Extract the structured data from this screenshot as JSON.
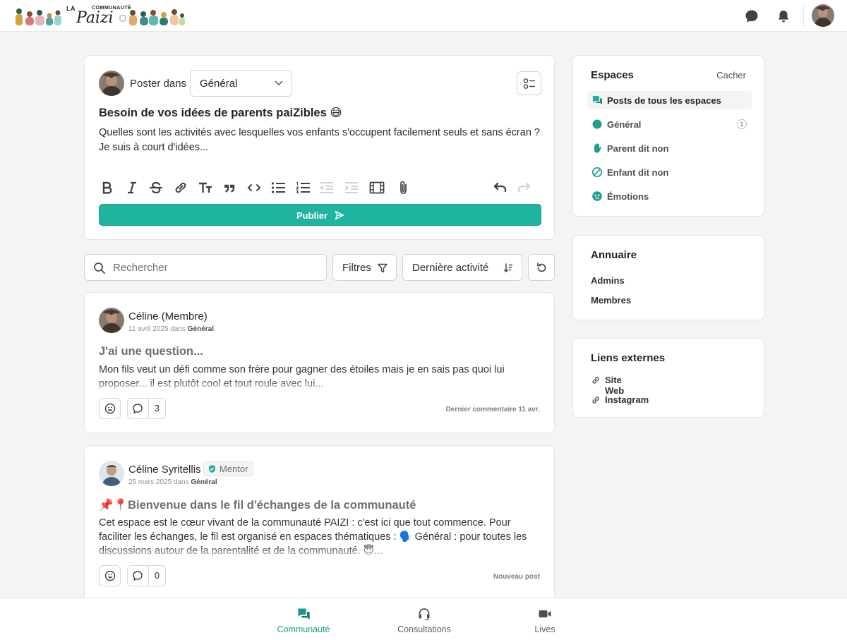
{
  "colors": {
    "accent": "#1fb4a0",
    "accent_dark": "#169c8b",
    "mentor_check": "#1fb4a0"
  },
  "header": {
    "logo": {
      "la": "LA",
      "communaute": "COMMUNAUTÉ",
      "paizi": "Paizi"
    },
    "icons": [
      "chat-bubble-icon",
      "bell-icon"
    ]
  },
  "composer": {
    "post_in_label": "Poster dans",
    "space_select": "Général",
    "title": "Besoin de vos idées de parents paiZibles 😅",
    "body": "Quelles sont les activités avec lesquelles vos enfants s'occupent facilement seuls et sans écran ? Je suis à court d'idées...",
    "publish_label": "Publier"
  },
  "search": {
    "placeholder": "Rechercher"
  },
  "filters_label": "Filtres",
  "sort_label": "Dernière activité",
  "posts": [
    {
      "author": "Céline (Membre)",
      "date": "11 avril 2025",
      "in_word": "dans",
      "space": "Général",
      "title": "J'ai une question...",
      "excerpt": "Mon fils veut un défi comme son frère pour gagner des étoiles mais je en sais pas quoi lui proposer... il est plutôt cool et tout roule avec lui...",
      "comments": "3",
      "right_note": "Dernier commentaire 11 avr."
    },
    {
      "author": "Céline Syritellis",
      "badge": "Mentor",
      "date": "25 mars 2025",
      "in_word": "dans",
      "space": "Général",
      "title": "📌📍Bienvenue dans le fil d'échanges de la communauté",
      "excerpt": "Cet espace est le cœur vivant de la communauté PAIZI : c'est ici que tout commence. Pour faciliter les échanges, le fil est organisé en espaces thématiques : 🗣️ Général : pour toutes les discussions autour de la parentalité et de la communauté. 😇...",
      "comments": "0",
      "right_note": "Nouveau post"
    }
  ],
  "sidebar": {
    "spaces": {
      "title": "Espaces",
      "hide_label": "Cacher",
      "items": [
        {
          "label": "Posts de tous les espaces",
          "icon": "chat-bubbles-icon",
          "active": true
        },
        {
          "label": "Général",
          "icon": "teal-dot-icon",
          "badge": "1"
        },
        {
          "label": "Parent dit non",
          "icon": "hand-stop-icon"
        },
        {
          "label": "Enfant dit non",
          "icon": "forbidden-icon"
        },
        {
          "label": "Émotions",
          "icon": "angry-face-icon"
        }
      ]
    },
    "directory": {
      "title": "Annuaire",
      "items": [
        "Admins",
        "Membres"
      ]
    },
    "links": {
      "title": "Liens externes",
      "items": [
        "Site Web",
        "Instagram"
      ]
    }
  },
  "bottom_nav": [
    {
      "label": "Communauté",
      "icon": "chat-bubbles-icon",
      "active": true
    },
    {
      "label": "Consultations",
      "icon": "headset-icon"
    },
    {
      "label": "Lives",
      "icon": "video-camera-icon"
    }
  ]
}
